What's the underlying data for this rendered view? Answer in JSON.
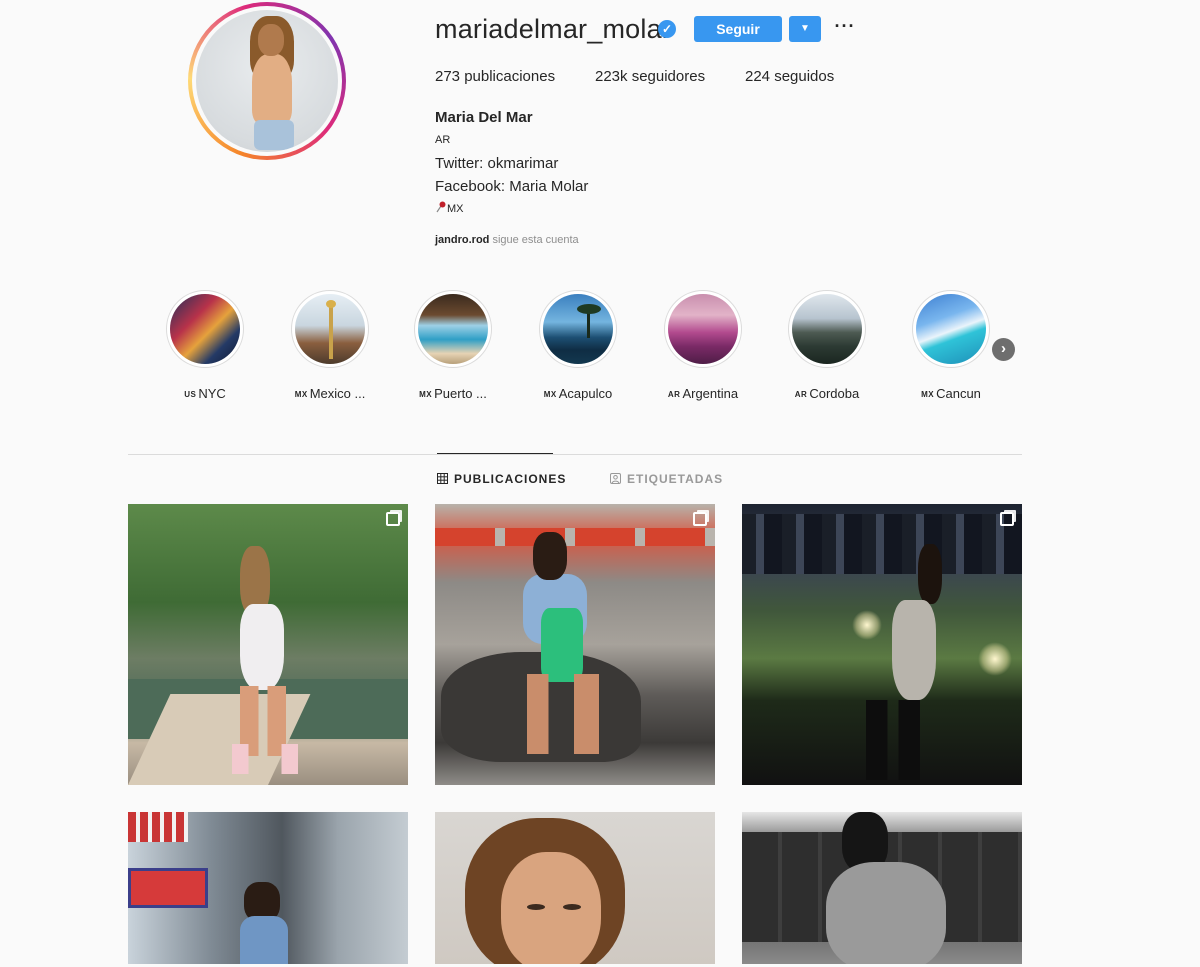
{
  "profile": {
    "username": "mariadelmar_molar",
    "verified_icon": "verified-badge-icon",
    "follow_label": "Seguir",
    "dropdown_icon": "caret-down-icon",
    "more_icon": "more-options-icon",
    "more_symbol": "···"
  },
  "stats": {
    "posts": "273 publicaciones",
    "followers": "223k seguidores",
    "following": "224 seguidos"
  },
  "bio": {
    "name": "Maria Del Mar",
    "country": "AR",
    "twitter": "Twitter: okmarimar",
    "facebook": "Facebook: Maria Molar",
    "location": "MX"
  },
  "followed_by": {
    "user": "jandro.rod",
    "text": " sigue esta cuenta"
  },
  "highlights": [
    {
      "cc": "US",
      "label": "NYC"
    },
    {
      "cc": "MX",
      "label": "Mexico ..."
    },
    {
      "cc": "MX",
      "label": "Puerto ..."
    },
    {
      "cc": "MX",
      "label": "Acapulco"
    },
    {
      "cc": "AR",
      "label": "Argentina"
    },
    {
      "cc": "AR",
      "label": "Cordoba"
    },
    {
      "cc": "MX",
      "label": "Cancun"
    }
  ],
  "tabs": {
    "posts": "PUBLICACIONES",
    "tagged": "ETIQUETADAS"
  },
  "colors": {
    "accent": "#3897f0",
    "text": "#262626",
    "muted": "#8e8e8e",
    "background": "#fafafa"
  }
}
